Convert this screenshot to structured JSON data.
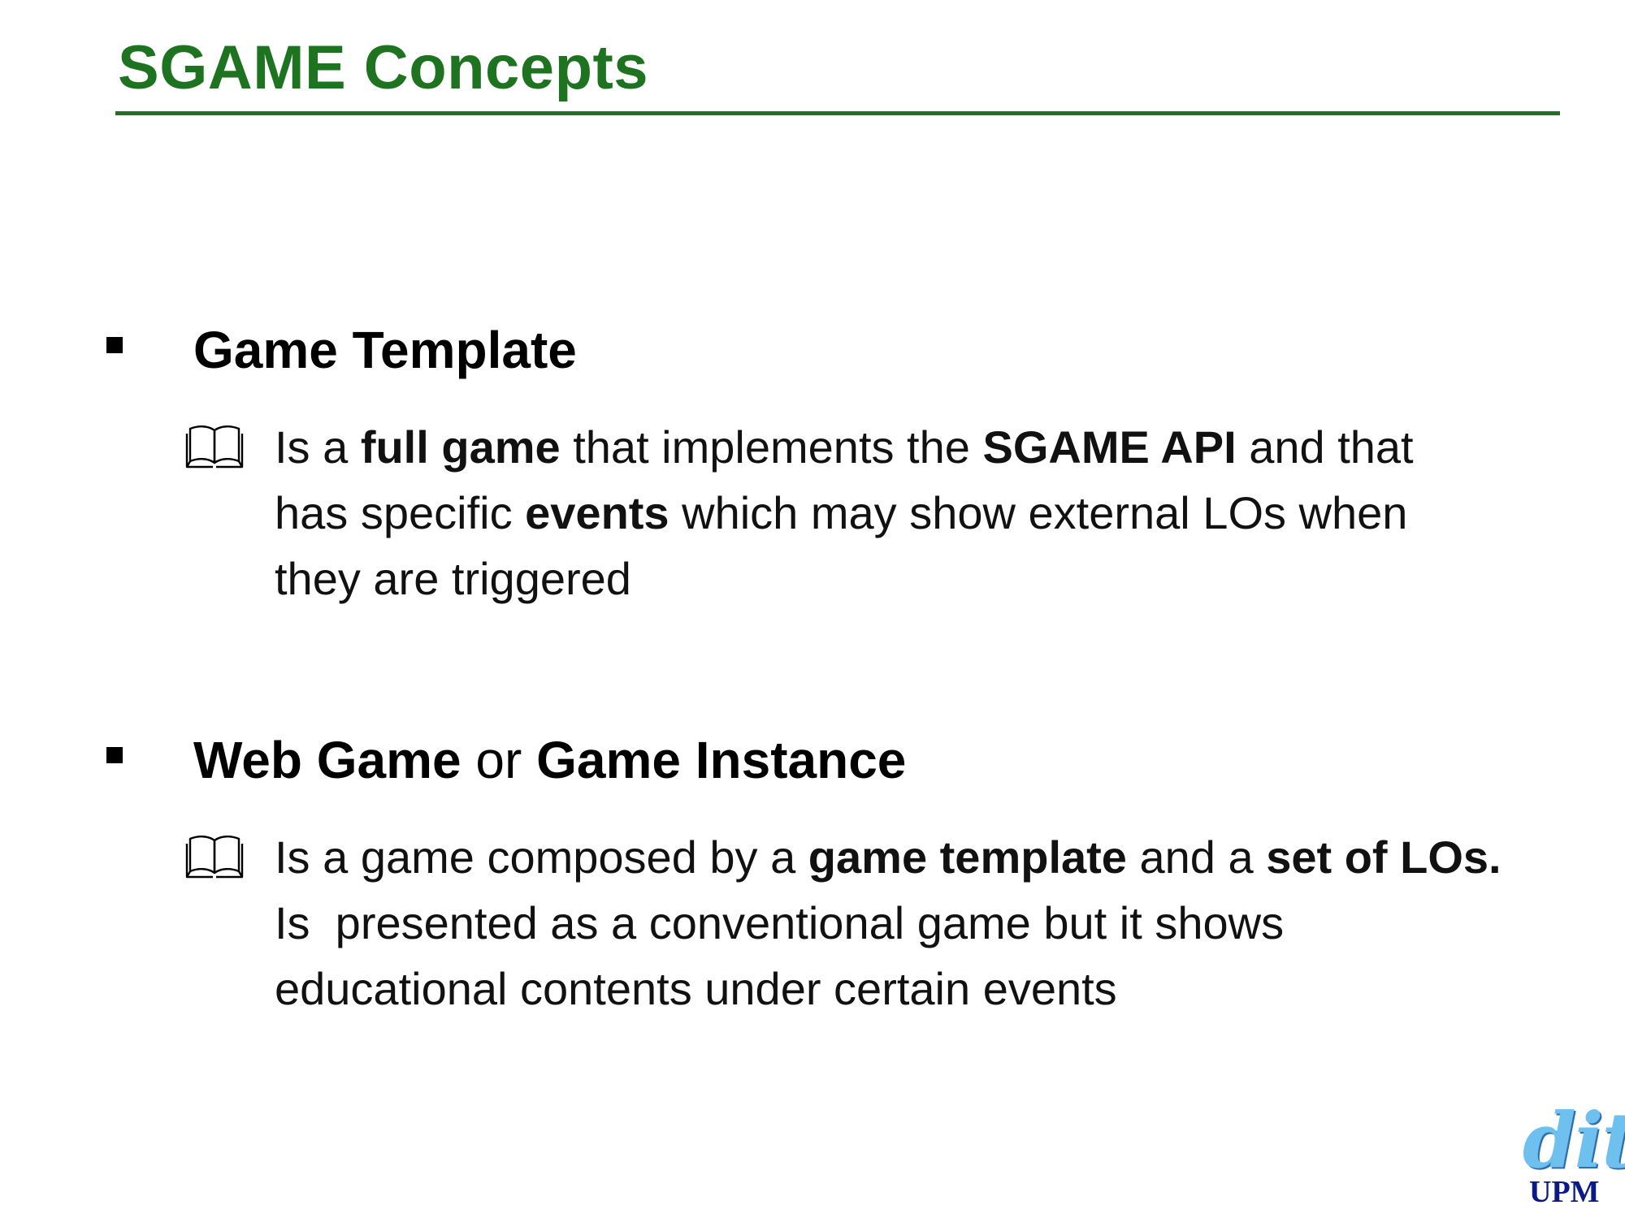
{
  "slide": {
    "title": "SGAME Concepts",
    "sections": [
      {
        "heading": {
          "a": "Game Template"
        },
        "lines": [
          {
            "t1": "Is a ",
            "b1": "full game",
            "t2": " that implements the ",
            "b2": "SGAME API",
            "t3": " and that"
          },
          {
            "t1": "has specific ",
            "b1": "events",
            "t2": " which may show external LOs when"
          },
          {
            "t1": "they are triggered"
          }
        ]
      },
      {
        "heading": {
          "a": "Web Game",
          "b": " or ",
          "c": "Game Instance"
        },
        "lines": [
          {
            "t1": "Is a game composed by a ",
            "b1": "game template",
            "t2": " and a ",
            "b2": "set of LOs."
          },
          {
            "t1": "Is  presented as a conventional game but it shows"
          },
          {
            "t1": "educational contents under certain events"
          }
        ]
      }
    ],
    "icons": {
      "bullet": "square-bullet-icon",
      "sub_bullet": "open-book-icon"
    },
    "colors": {
      "title": "#1e7320",
      "text": "#111111",
      "logo_dit": "#6ec1ef",
      "logo_upm": "#0a1a86"
    }
  },
  "logo": {
    "dit": "dit",
    "upm": "UPM"
  }
}
